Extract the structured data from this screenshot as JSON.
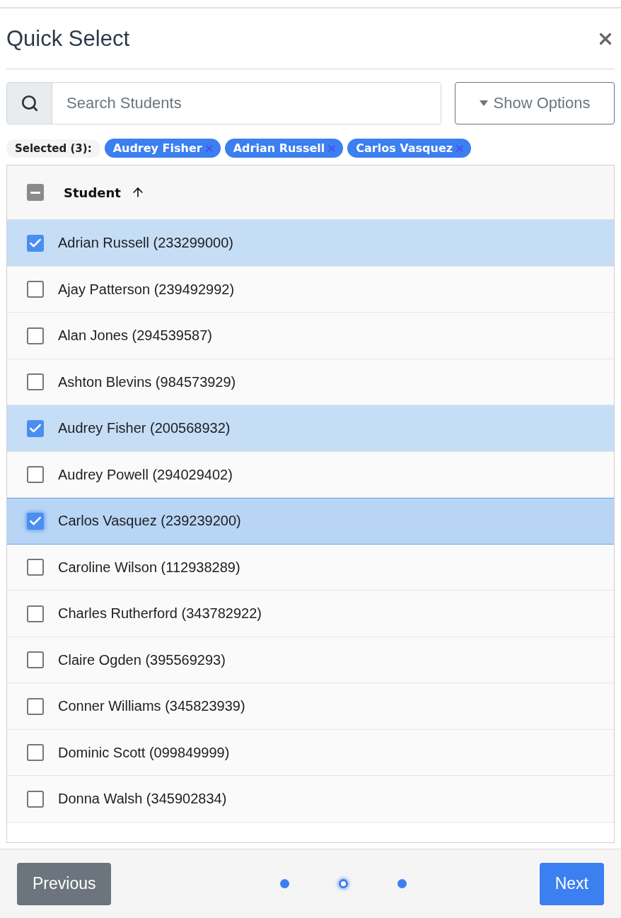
{
  "dialog": {
    "title": "Quick Select"
  },
  "search": {
    "placeholder": "Search Students"
  },
  "options_button": {
    "label": "Show Options"
  },
  "selected_summary": {
    "label": "Selected (3):",
    "chips": [
      "Audrey Fisher",
      "Adrian Russell",
      "Carlos Vasquez"
    ]
  },
  "table": {
    "header": {
      "label": "Student",
      "indeterminate": true
    },
    "rows": [
      {
        "label": "Adrian Russell (233299000)",
        "selected": true,
        "focused": false
      },
      {
        "label": "Ajay Patterson (239492992)",
        "selected": false,
        "focused": false
      },
      {
        "label": "Alan Jones (294539587)",
        "selected": false,
        "focused": false
      },
      {
        "label": "Ashton Blevins (984573929)",
        "selected": false,
        "focused": false
      },
      {
        "label": "Audrey Fisher (200568932)",
        "selected": true,
        "focused": false
      },
      {
        "label": "Audrey Powell (294029402)",
        "selected": false,
        "focused": false
      },
      {
        "label": "Carlos Vasquez (239239200)",
        "selected": true,
        "focused": true
      },
      {
        "label": "Caroline Wilson (112938289)",
        "selected": false,
        "focused": false
      },
      {
        "label": "Charles Rutherford (343782922)",
        "selected": false,
        "focused": false
      },
      {
        "label": "Claire Ogden (395569293)",
        "selected": false,
        "focused": false
      },
      {
        "label": "Conner Williams (345823939)",
        "selected": false,
        "focused": false
      },
      {
        "label": "Dominic Scott (099849999)",
        "selected": false,
        "focused": false
      },
      {
        "label": "Donna Walsh (345902834)",
        "selected": false,
        "focused": false
      }
    ]
  },
  "footer": {
    "previous": "Previous",
    "next": "Next",
    "steps": [
      {
        "selected": false
      },
      {
        "selected": true
      },
      {
        "selected": false
      }
    ]
  }
}
